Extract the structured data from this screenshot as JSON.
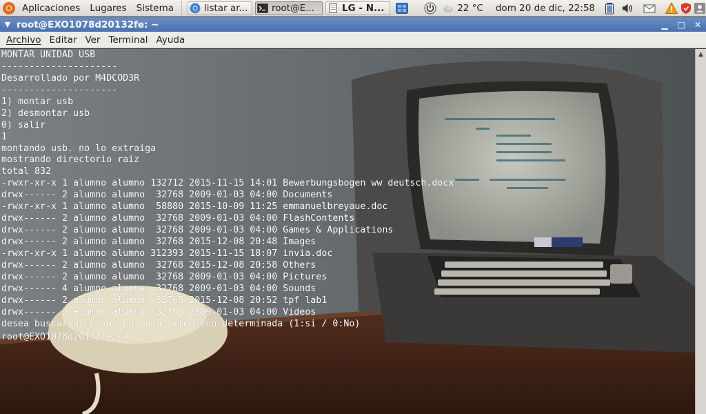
{
  "panel": {
    "menus": [
      "Aplicaciones",
      "Lugares",
      "Sistema"
    ],
    "tasks": [
      {
        "label": "listar ar...",
        "icon": "chrome-icon"
      },
      {
        "label": "root@E...",
        "icon": "terminal-icon",
        "active": true
      },
      {
        "label": "LG - N...",
        "icon": "document-icon"
      }
    ],
    "weather": "22 °C",
    "clock": "dom 20 de dic, 22:58"
  },
  "window": {
    "title": "root@EXO1078d20132fe: ~"
  },
  "menubar": [
    "Archivo",
    "Editar",
    "Ver",
    "Terminal",
    "Ayuda"
  ],
  "terminal": {
    "lines": [
      "MONTAR UNIDAD USB",
      "---------------------",
      "Desarrollado por M4DCOD3R",
      "---------------------",
      "1) montar usb",
      "2) desmontar usb",
      "0) salir",
      "1",
      "montando usb. no lo extraiga",
      "mostrando directorio raiz",
      "total 832",
      "-rwxr-xr-x 1 alumno alumno 132712 2015-11-15 14:01 Bewerbungsbogen ww deutsch.docx",
      "drwx------ 2 alumno alumno  32768 2009-01-03 04:00 Documents",
      "-rwxr-xr-x 1 alumno alumno  58880 2015-10-09 11:25 emmanuelbreyaue.doc",
      "drwx------ 2 alumno alumno  32768 2009-01-03 04:00 FlashContents",
      "drwx------ 2 alumno alumno  32768 2009-01-03 04:00 Games & Applications",
      "drwx------ 2 alumno alumno  32768 2015-12-08 20:48 Images",
      "-rwxr-xr-x 1 alumno alumno 312393 2015-11-15 18:07 invia.doc",
      "drwx------ 2 alumno alumno  32768 2015-12-08 20:58 Others",
      "drwx------ 2 alumno alumno  32768 2009-01-03 04:00 Pictures",
      "drwx------ 4 alumno alumno  32768 2009-01-03 04:00 Sounds",
      "drwx------ 2 alumno alumno  32768 2015-12-08 20:52 tpf lab1",
      "drwx------ 2 alumno alumno  32768 2009-01-03 04:00 Videos",
      "desea buscar archivos por una extension determinada (1:si / 0:No)"
    ],
    "prompt": "root@EXO1078d20132fe:~#"
  }
}
